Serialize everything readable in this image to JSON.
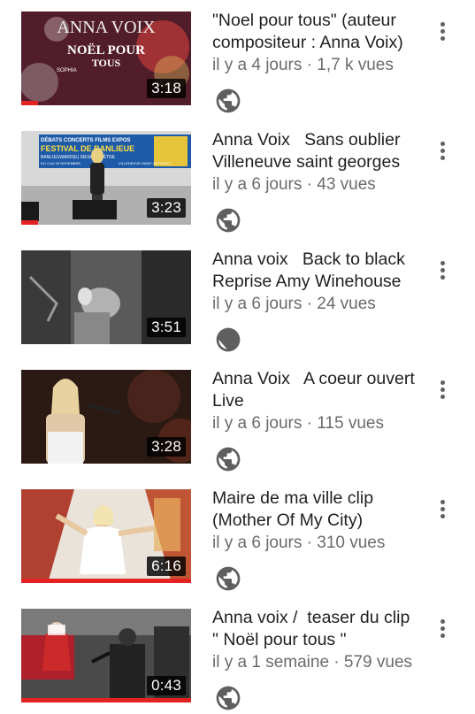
{
  "videos": [
    {
      "title": "\"Noel pour tous\" (auteur compositeur : Anna Voix)",
      "meta": "il y a 4 jours · 1,7 k vues",
      "duration": "3:18",
      "progress": 0.1,
      "thumb_text": [
        "ANNA VOIX",
        "NOËL POUR",
        "TOUS",
        "SOPHIA"
      ]
    },
    {
      "title": "Anna Voix   Sans oublier Villeneuve saint georges",
      "meta": "il y a 6 jours · 43 vues",
      "duration": "3:23",
      "progress": 0.1,
      "thumb_text": [
        "DÉBATS  CONCERTS  FILMS  EXPOS",
        "FESTIVAL DE BANLIEUE",
        "BANLIEUWARD(E)  SIES/ DE L'ÊTRE",
        "DU 4 AU 30 NOVEMBRE",
        "VILLENEUVE-SAINT-GEORGES"
      ]
    },
    {
      "title": "Anna voix   Back to black Reprise Amy Winehouse",
      "meta": "il y a 6 jours · 24 vues",
      "duration": "3:51",
      "progress": 0
    },
    {
      "title": "Anna Voix   A coeur ouvert Live",
      "meta": "il y a 6 jours · 115 vues",
      "duration": "3:28",
      "progress": 0
    },
    {
      "title": "Maire de ma ville clip (Mother Of My City)",
      "meta": "il y a 6 jours · 310 vues",
      "duration": "6:16",
      "progress": 1
    },
    {
      "title": "Anna voix /  teaser du clip \" Noël pour tous \"",
      "meta": "il y a 1 semaine · 579 vues",
      "duration": "0:43",
      "progress": 1
    }
  ],
  "icons": {
    "visibility": "globe-icon",
    "menu": "more-vert-icon"
  },
  "colors": {
    "progress": "#e52222",
    "meta_text": "#6b6b6b",
    "title_text": "#1f1f1f"
  }
}
